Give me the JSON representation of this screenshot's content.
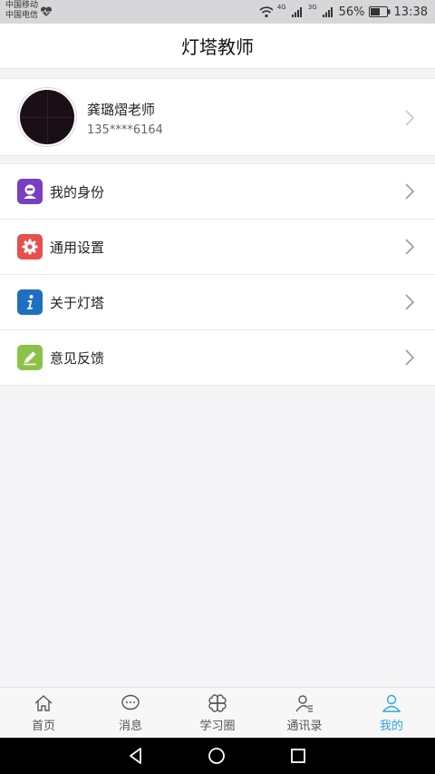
{
  "status_bar": {
    "carrier_1": "中国移动",
    "carrier_2": "中国电信",
    "network_1": "4G",
    "network_2": "3G",
    "battery": "56%",
    "time": "13:38"
  },
  "header": {
    "title": "灯塔教师"
  },
  "profile": {
    "name": "龚璐熠老师",
    "phone": "135****6164"
  },
  "menu": {
    "items": [
      {
        "label": "我的身份",
        "icon": "identity-icon",
        "color": "#7a3fc0"
      },
      {
        "label": "通用设置",
        "icon": "gear-icon",
        "color": "#e8504d"
      },
      {
        "label": "关于灯塔",
        "icon": "info-icon",
        "color": "#1e6fc0"
      },
      {
        "label": "意见反馈",
        "icon": "pencil-icon",
        "color": "#8bc34a"
      }
    ]
  },
  "tabs": {
    "items": [
      {
        "label": "首页",
        "icon": "home-icon"
      },
      {
        "label": "消息",
        "icon": "message-icon"
      },
      {
        "label": "学习圈",
        "icon": "clover-icon"
      },
      {
        "label": "通讯录",
        "icon": "contacts-icon"
      },
      {
        "label": "我的",
        "icon": "person-icon",
        "active": true
      }
    ],
    "active_color": "#2aa7d6"
  }
}
